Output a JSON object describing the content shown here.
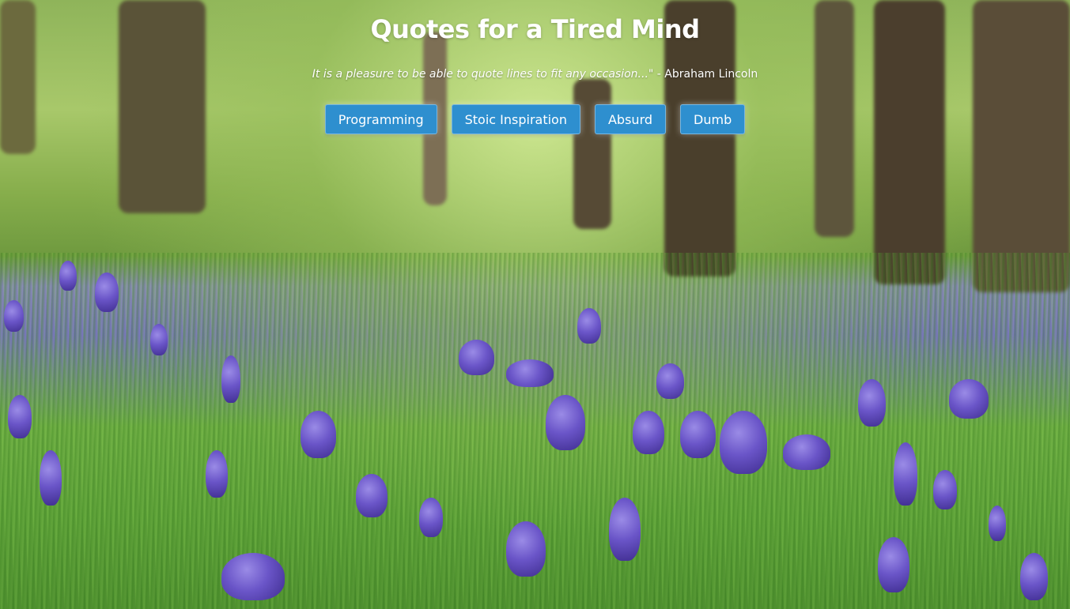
{
  "header": {
    "title": "Quotes for a Tired Mind",
    "quote_text": "It is a pleasure to be able to quote lines to fit any occasion...\"",
    "quote_author": "- Abraham Lincoln"
  },
  "categories": {
    "programming": "Programming",
    "stoic": "Stoic Inspiration",
    "absurd": "Absurd",
    "dumb": "Dumb"
  },
  "colors": {
    "button_bg": "#2e8fcf",
    "text": "#ffffff"
  }
}
